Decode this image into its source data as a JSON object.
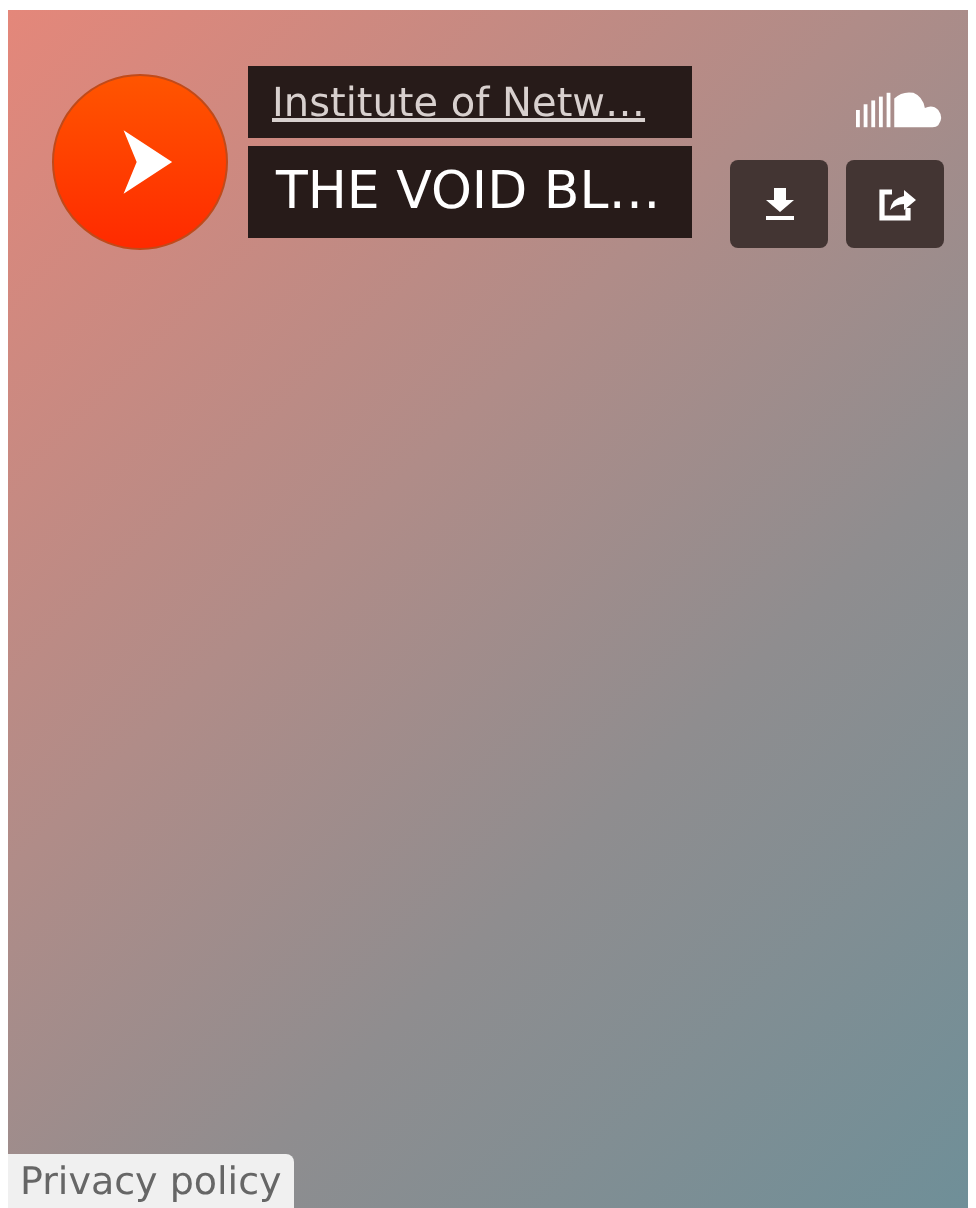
{
  "artist": "Institute of Netw…",
  "title": "THE VOID BL…",
  "footer": {
    "link": "Privacy policy"
  }
}
